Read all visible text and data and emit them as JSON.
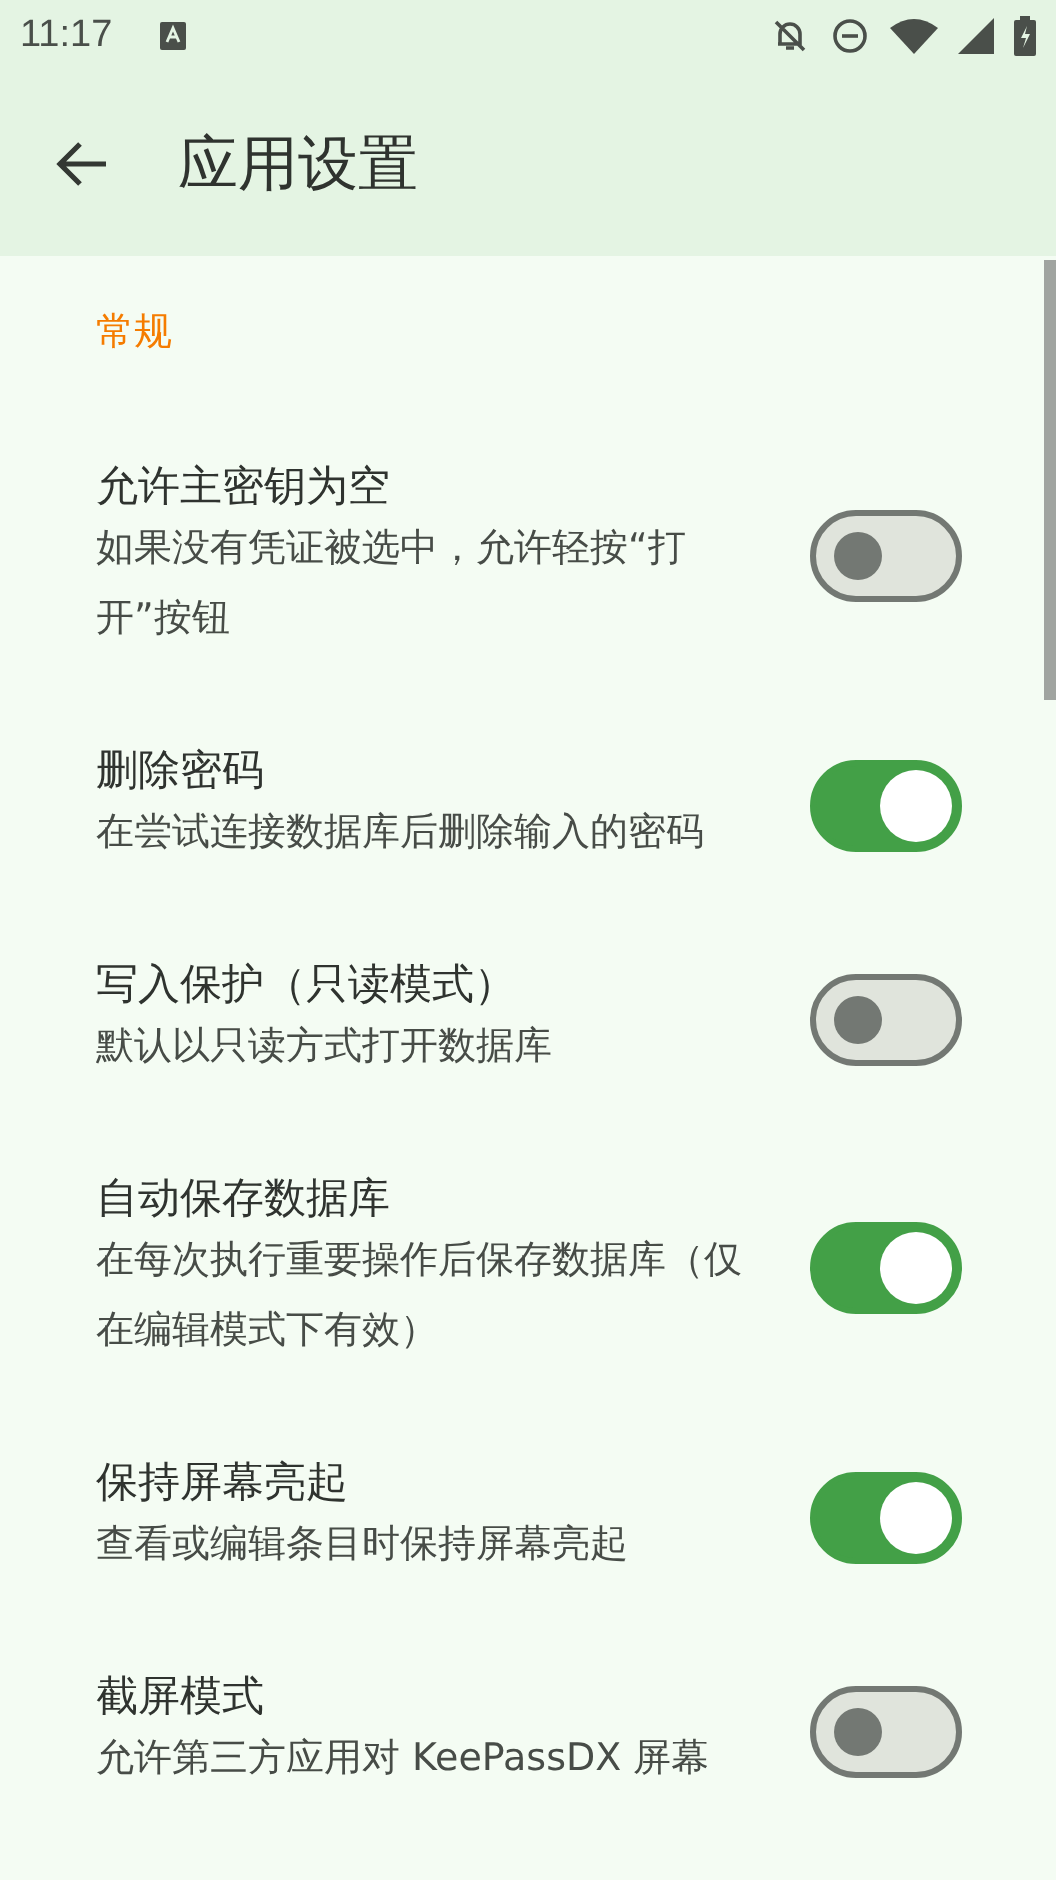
{
  "status_bar": {
    "time": "11:17"
  },
  "app_bar": {
    "title": "应用设置"
  },
  "section": {
    "title": "常规"
  },
  "settings": [
    {
      "title": "允许主密钥为空",
      "subtitle": "如果没有凭证被选中，允许轻按“打开”按钮",
      "on": false
    },
    {
      "title": "删除密码",
      "subtitle": "在尝试连接数据库后删除输入的密码",
      "on": true
    },
    {
      "title": "写入保护（只读模式）",
      "subtitle": "默认以只读方式打开数据库",
      "on": false
    },
    {
      "title": "自动保存数据库",
      "subtitle": "在每次执行重要操作后保存数据库（仅在编辑模式下有效）",
      "on": true
    },
    {
      "title": "保持屏幕亮起",
      "subtitle": "查看或编辑条目时保持屏幕亮起",
      "on": true
    },
    {
      "title": "截屏模式",
      "subtitle": "允许第三方应用对 KeePassDX 屏幕",
      "on": false
    }
  ]
}
